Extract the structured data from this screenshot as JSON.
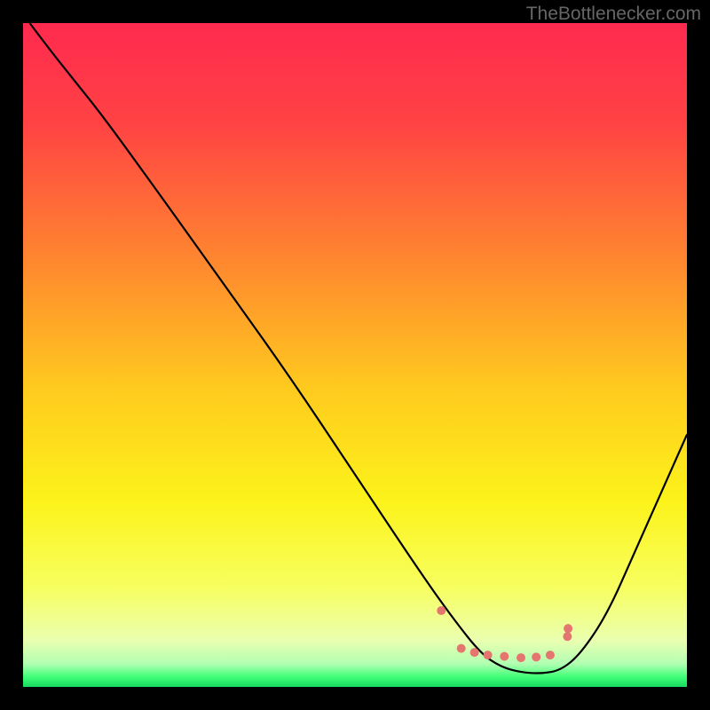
{
  "watermark": "TheBottlenecker.com",
  "chart_data": {
    "type": "line",
    "title": "",
    "xlabel": "",
    "ylabel": "",
    "xlim": [
      0,
      100
    ],
    "ylim": [
      0,
      100
    ],
    "series": [
      {
        "name": "curve",
        "color": "#000000",
        "x": [
          1,
          4,
          8,
          12,
          20,
          30,
          40,
          50,
          60,
          65,
          69,
          72,
          75,
          78,
          81,
          84,
          88,
          92,
          96,
          100
        ],
        "y": [
          100,
          96,
          91,
          86,
          75,
          61,
          47,
          32,
          17,
          10,
          5,
          3,
          2.2,
          2,
          2.5,
          5,
          11,
          20,
          29,
          38
        ]
      }
    ],
    "markers": {
      "name": "highlight-points",
      "color": "#e5766f",
      "radius": 5,
      "x": [
        63,
        66,
        68,
        70,
        72.5,
        75,
        77.3,
        79.4,
        82,
        82.1
      ],
      "y": [
        11.5,
        5.8,
        5.2,
        4.8,
        4.6,
        4.4,
        4.5,
        4.8,
        7.6,
        8.8
      ]
    },
    "background_gradient": {
      "stops": [
        {
          "offset": 0.0,
          "color": "#ff2a4f"
        },
        {
          "offset": 0.15,
          "color": "#ff4244"
        },
        {
          "offset": 0.35,
          "color": "#ff8430"
        },
        {
          "offset": 0.55,
          "color": "#ffca1e"
        },
        {
          "offset": 0.72,
          "color": "#fcf31a"
        },
        {
          "offset": 0.85,
          "color": "#f7ff60"
        },
        {
          "offset": 0.93,
          "color": "#eaffb0"
        },
        {
          "offset": 0.965,
          "color": "#b2ffb2"
        },
        {
          "offset": 0.985,
          "color": "#3fff77"
        },
        {
          "offset": 1.0,
          "color": "#18d860"
        }
      ]
    }
  }
}
